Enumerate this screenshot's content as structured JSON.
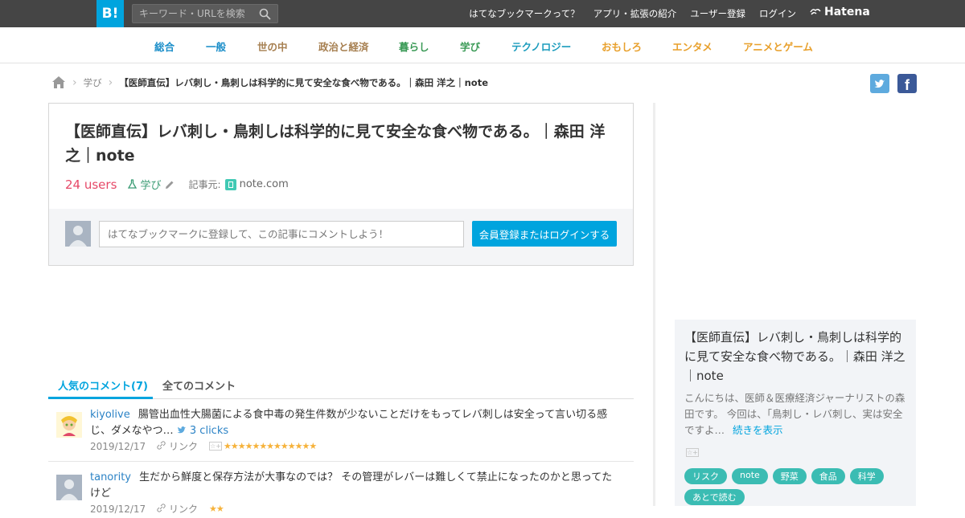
{
  "topbar": {
    "logo": "B!",
    "search_placeholder": "キーワード・URLを検索",
    "links": [
      "はてなブックマークって？",
      "アプリ・拡張の紹介",
      "ユーザー登録",
      "ログイン"
    ],
    "hatena": "Hatena"
  },
  "categories": [
    {
      "label": "総合",
      "color": "#1b8ec9"
    },
    {
      "label": "一般",
      "color": "#1b8ec9"
    },
    {
      "label": "世の中",
      "color": "#a67f50"
    },
    {
      "label": "政治と経済",
      "color": "#a67f50"
    },
    {
      "label": "暮らし",
      "color": "#3a9a56"
    },
    {
      "label": "学び",
      "color": "#3a9a56"
    },
    {
      "label": "テクノロジー",
      "color": "#1b9cbd"
    },
    {
      "label": "おもしろ",
      "color": "#e8a02c"
    },
    {
      "label": "エンタメ",
      "color": "#e8a02c"
    },
    {
      "label": "アニメとゲーム",
      "color": "#e8a02c"
    }
  ],
  "breadcrumb": {
    "category": "学び",
    "current": "【医師直伝】レバ刺し・鳥刺しは科学的に見て安全な食べ物である。｜森田 洋之｜note"
  },
  "share": {
    "twitter": "t",
    "facebook": "f"
  },
  "entry": {
    "title": "【医師直伝】レバ刺し・鳥刺しは科学的に見て安全な食べ物である。｜森田 洋之｜note",
    "users": "24 users",
    "category": "学び",
    "source_label": "記事元:",
    "source": "note.com",
    "comment_placeholder": "はてなブックマークに登録して、この記事にコメントしよう！",
    "login_button": "会員登録またはログインする"
  },
  "tabs": {
    "popular": "人気のコメント(7)",
    "all": "全てのコメント"
  },
  "comments": [
    {
      "user": "kiyolive",
      "text": "腸管出血性大腸菌による食中毒の発生件数が少ないことだけをもってレバ刺しは安全って言い切る感じ、ダメなやつ…",
      "clicks": "3 clicks",
      "date": "2019/12/17",
      "link_label": "リンク",
      "stars": "★★★★★★★★★★★★★"
    },
    {
      "user": "tanority",
      "text": "生だから鮮度と保存方法が大事なのでは？ その管理がレバーは難しくて禁止になったのかと思ってたけど",
      "date": "2019/12/17",
      "link_label": "リンク",
      "stars": "★★"
    }
  ],
  "card": {
    "title": "【医師直伝】レバ刺し・鳥刺しは科学的に見て安全な食べ物である。｜森田 洋之｜note",
    "description": "こんにちは、医師＆医療経済ジャーナリストの森田です。 今回は、「鳥刺し・レバ刺し、実は安全ですよ…",
    "more": "続きを表示",
    "tags": [
      "リスク",
      "note",
      "野菜",
      "食品",
      "科学",
      "あとで読む"
    ]
  }
}
